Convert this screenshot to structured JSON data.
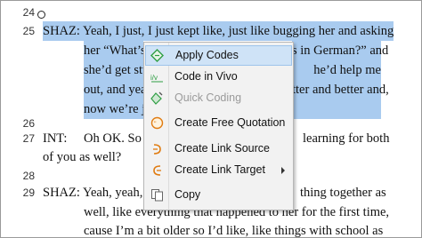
{
  "transcript": {
    "lines": [
      {
        "num": "24",
        "segments": []
      },
      {
        "num": "25",
        "segments": [
          "SHAZ:  Yeah, I just, I just kept like, just like bugging her and asking",
          "her “What’s",
          "s in German?” and",
          "she’d get stu",
          "he’d help me",
          "out, and yeal",
          "tter and better and,",
          "now we’re ju"
        ]
      },
      {
        "num": "26",
        "segments": []
      },
      {
        "num": "27",
        "segments": [
          "INT:",
          "Oh OK. So t",
          "learning for both",
          "of you as well?"
        ]
      },
      {
        "num": "28",
        "segments": []
      },
      {
        "num": "29",
        "segments": [
          "SHAZ:  Yeah, yeah, v",
          "thing together as",
          "well, like everything that happened to her for the first time,",
          "cause I’m a bit older so I’d like, like things with school as"
        ]
      }
    ]
  },
  "context_menu": {
    "items": [
      {
        "label": "Apply Codes",
        "icon": "apply-codes-icon",
        "selected": true
      },
      {
        "label": "Code in Vivo",
        "icon": "code-in-vivo-icon"
      },
      {
        "label": "Quick Coding",
        "icon": "quick-coding-icon",
        "disabled": true
      },
      {
        "label": "Create Free Quotation",
        "icon": "free-quotation-icon"
      },
      {
        "label": "Create Link Source",
        "icon": "link-source-icon"
      },
      {
        "label": "Create Link Target",
        "icon": "link-target-icon",
        "submenu": true
      },
      {
        "label": "Copy",
        "icon": "copy-icon"
      }
    ]
  },
  "colors": {
    "selection": "#a9cbef",
    "menu_bg": "#f2f2f2",
    "menu_highlight": "#cfe3f7",
    "icon_green": "#2f9e44",
    "icon_orange": "#e07b10"
  }
}
